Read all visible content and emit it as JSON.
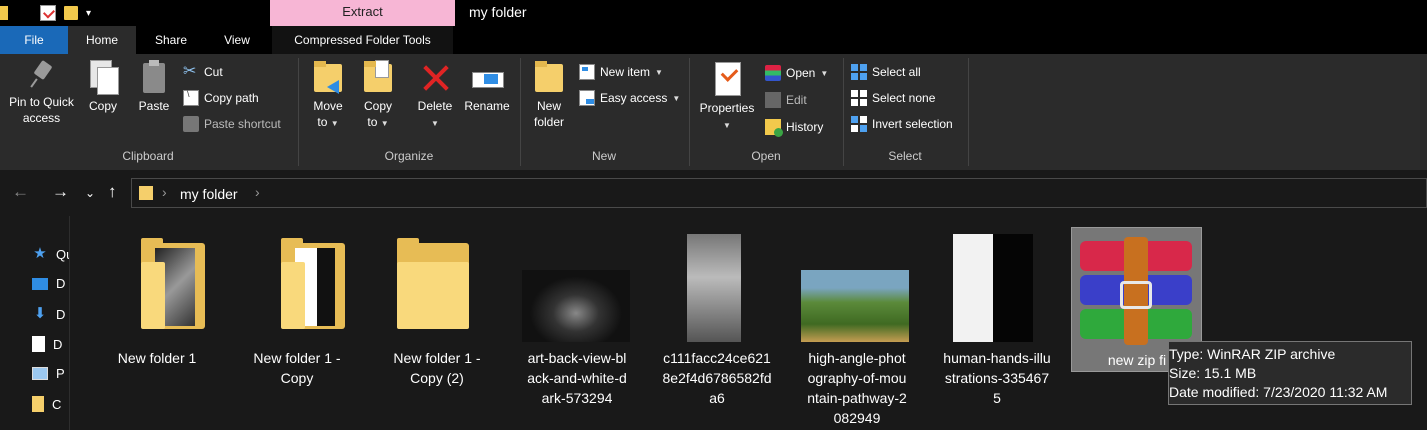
{
  "window": {
    "title": "my folder",
    "context_tab": "Extract"
  },
  "tabs": [
    "File",
    "Home",
    "Share",
    "View",
    "Compressed Folder Tools"
  ],
  "ribbon": {
    "clipboard": {
      "label": "Clipboard",
      "pin_line1": "Pin to Quick",
      "pin_line2": "access",
      "copy": "Copy",
      "paste": "Paste",
      "cut": "Cut",
      "copy_path": "Copy path",
      "paste_shortcut": "Paste shortcut"
    },
    "organize": {
      "label": "Organize",
      "move_line1": "Move",
      "move_line2": "to",
      "copy_line1": "Copy",
      "copy_line2": "to",
      "delete": "Delete",
      "rename": "Rename"
    },
    "new": {
      "label": "New",
      "folder_line1": "New",
      "folder_line2": "folder",
      "new_item": "New item",
      "easy_access": "Easy access"
    },
    "open": {
      "label": "Open",
      "properties": "Properties",
      "open": "Open",
      "edit": "Edit",
      "history": "History"
    },
    "select": {
      "label": "Select",
      "select_all": "Select all",
      "select_none": "Select none",
      "invert_selection": "Invert selection"
    }
  },
  "address": {
    "path": "my folder"
  },
  "navpane": {
    "items": [
      "Qu",
      "D",
      "D",
      "D",
      "P",
      "C"
    ]
  },
  "files": [
    {
      "line1": "New folder 1",
      "line2": "",
      "line3": "",
      "line4": ""
    },
    {
      "line1": "New folder 1 -",
      "line2": "Copy",
      "line3": "",
      "line4": ""
    },
    {
      "line1": "New folder 1 -",
      "line2": "Copy (2)",
      "line3": "",
      "line4": ""
    },
    {
      "line1": "art-back-view-bl",
      "line2": "ack-and-white-d",
      "line3": "ark-573294",
      "line4": ""
    },
    {
      "line1": "c111facc24ce621",
      "line2": "8e2f4d6786582fd",
      "line3": "a6",
      "line4": ""
    },
    {
      "line1": "high-angle-phot",
      "line2": "ography-of-mou",
      "line3": "ntain-pathway-2",
      "line4": "082949"
    },
    {
      "line1": "human-hands-illu",
      "line2": "strations-335467",
      "line3": "5",
      "line4": ""
    },
    {
      "line1": "new zip fi",
      "line2": "",
      "line3": "",
      "line4": ""
    }
  ],
  "tooltip": {
    "type": "Type: WinRAR ZIP archive",
    "size": "Size: 15.1 MB",
    "modified": "Date modified: 7/23/2020 11:32 AM"
  }
}
